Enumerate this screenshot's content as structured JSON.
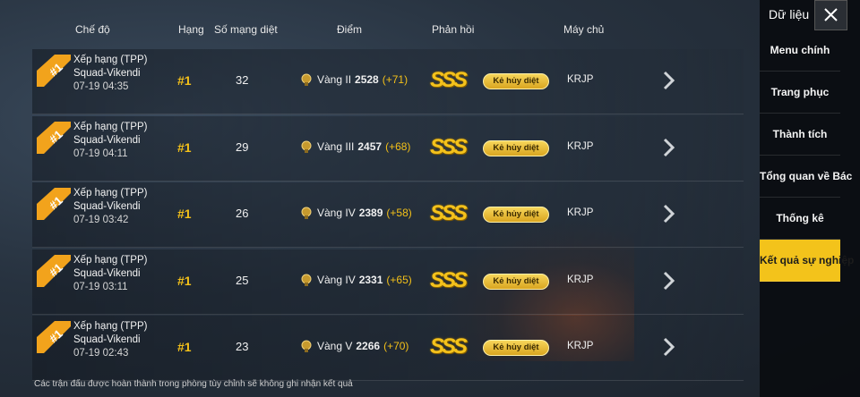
{
  "header": {
    "mode": "Chế độ",
    "rank": "Hạng",
    "kills": "Số mạng diệt",
    "score": "Điểm",
    "feedback": "Phản hồi",
    "server": "Máy chủ"
  },
  "rows": [
    {
      "mode": "Xếp hạng (TPP)",
      "map": "Squad-Vikendi",
      "date": "07-19 04:35",
      "rank": "#1",
      "kills": "32",
      "tier": "Vàng II",
      "points": "2528",
      "gain": "(+71)",
      "grade": "SSS",
      "tag": "Kẻ hủy diệt",
      "server": "KRJP"
    },
    {
      "mode": "Xếp hạng (TPP)",
      "map": "Squad-Vikendi",
      "date": "07-19 04:11",
      "rank": "#1",
      "kills": "29",
      "tier": "Vàng III",
      "points": "2457",
      "gain": "(+68)",
      "grade": "SSS",
      "tag": "Kẻ hủy diệt",
      "server": "KRJP"
    },
    {
      "mode": "Xếp hạng (TPP)",
      "map": "Squad-Vikendi",
      "date": "07-19 03:42",
      "rank": "#1",
      "kills": "26",
      "tier": "Vàng IV",
      "points": "2389",
      "gain": "(+58)",
      "grade": "SSS",
      "tag": "Kẻ hủy diệt",
      "server": "KRJP"
    },
    {
      "mode": "Xếp hạng (TPP)",
      "map": "Squad-Vikendi",
      "date": "07-19 03:11",
      "rank": "#1",
      "kills": "25",
      "tier": "Vàng IV",
      "points": "2331",
      "gain": "(+65)",
      "grade": "SSS",
      "tag": "Kẻ hủy diệt",
      "server": "KRJP"
    },
    {
      "mode": "Xếp hạng (TPP)",
      "map": "Squad-Vikendi",
      "date": "07-19 02:43",
      "rank": "#1",
      "kills": "23",
      "tier": "Vàng V",
      "points": "2266",
      "gain": "(+70)",
      "grade": "SSS",
      "tag": "Kẻ hủy diệt",
      "server": "KRJP"
    }
  ],
  "badge_text": "#1",
  "footer": "Các trận đấu được hoàn thành trong phòng tùy chỉnh sẽ không ghi nhận kết quả",
  "sidebar": {
    "title": "Dữ liệu",
    "items": [
      {
        "label": "Menu chính"
      },
      {
        "label": "Trang phục"
      },
      {
        "label": "Thành tích"
      },
      {
        "label": "Tổng quan về Bác"
      },
      {
        "label": "Thống kê"
      },
      {
        "label": "Kết quả sự nghiệp",
        "active": true
      }
    ]
  },
  "colors": {
    "accent": "#f3c31b",
    "background": "#27323f"
  }
}
